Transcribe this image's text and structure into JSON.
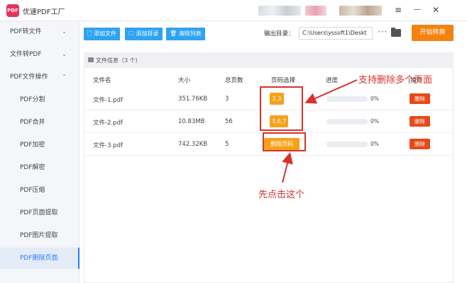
{
  "app": {
    "logo_text": "PDF",
    "title": "优速PDF工厂"
  },
  "window": {
    "menu_glyph": "≡",
    "minimize_glyph": "—",
    "close_glyph": "✕"
  },
  "sidebar": {
    "items": [
      {
        "label": "PDF转文件",
        "chevron": "⌄",
        "level": "top"
      },
      {
        "label": "文件转PDF",
        "chevron": "⌄",
        "level": "top"
      },
      {
        "label": "PDF文件操作",
        "chevron": "⌃",
        "level": "top"
      },
      {
        "label": "PDF分割",
        "level": "sub"
      },
      {
        "label": "PDF合并",
        "level": "sub"
      },
      {
        "label": "PDF加密",
        "level": "sub"
      },
      {
        "label": "PDF解密",
        "level": "sub"
      },
      {
        "label": "PDF压缩",
        "level": "sub"
      },
      {
        "label": "PDF页面提取",
        "level": "sub"
      },
      {
        "label": "PDF图片提取",
        "level": "sub"
      },
      {
        "label": "PDF删除页面",
        "level": "sub",
        "active": true
      }
    ]
  },
  "toolbar": {
    "add_file": "添加文件",
    "add_folder": "添加目录",
    "clear_list": "清除列表",
    "output_label": "输出目录：",
    "output_path": "C:\\Users\\yssoft1\\Deskt",
    "browse_dots": "···",
    "start": "开始转换"
  },
  "panel": {
    "title": "文件信息（3 个）",
    "columns": {
      "name": "文件名",
      "size": "大小",
      "pages": "总页数",
      "page_select": "页码选择",
      "progress": "进度",
      "action": "操作"
    },
    "rows": [
      {
        "name": "文件-1.pdf",
        "size": "351.76KB",
        "pages": "3",
        "page_select": "2,3",
        "progress": "0%",
        "delete": "删除"
      },
      {
        "name": "文件-2.pdf",
        "size": "10.83MB",
        "pages": "56",
        "page_select": "3,6,7",
        "progress": "0%",
        "delete": "删除"
      },
      {
        "name": "文件-3.pdf",
        "size": "742.32KB",
        "pages": "5",
        "page_select": "删除页码",
        "progress": "0%",
        "delete": "删除"
      }
    ]
  },
  "annotations": {
    "support_text": "支持删除多个页面",
    "click_text": "先点击这个"
  },
  "colors": {
    "accent_blue": "#2fa3f3",
    "start_orange": "#f5820f",
    "tag_orange": "#f5a21a",
    "delete_red": "#e64a19",
    "annotation_red": "#d9302f"
  }
}
